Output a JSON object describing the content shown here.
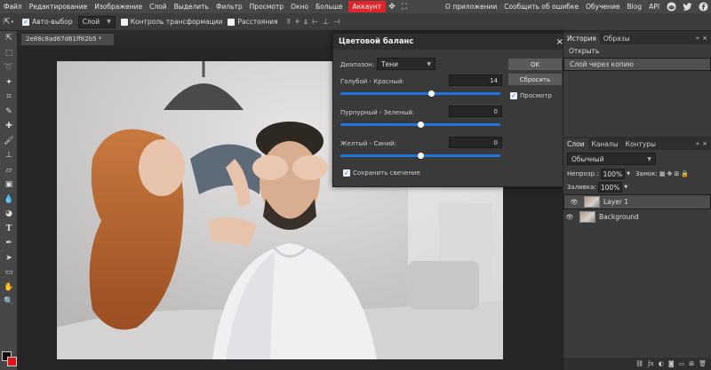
{
  "menu": {
    "items": [
      "Файл",
      "Редактирование",
      "Изображение",
      "Слой",
      "Выделить",
      "Фильтр",
      "Просмотр",
      "Окно",
      "Больше"
    ],
    "account": "Аккаунт",
    "links": [
      "О приложении",
      "Сообщить об ошибке",
      "Обучение",
      "Blog",
      "API"
    ]
  },
  "options": {
    "auto_select": "Авто-выбор",
    "layer_select": "Слой",
    "transform_controls": "Контроль трансформации",
    "distances": "Расстояния"
  },
  "document": {
    "tab_label": "2e88c8ad67d61ff82b5 *",
    "tab_close": "×"
  },
  "dialog": {
    "title": "Цветовой баланс",
    "close": "×",
    "range_label": "Диапазон:",
    "range_value": "Тени",
    "slider1": {
      "label": "Голубой - Красный:",
      "value": "14",
      "level": 14
    },
    "slider2": {
      "label": "Пурпурный - Зеленый:",
      "value": "0",
      "level": 0
    },
    "slider3": {
      "label": "Желтый - Синий:",
      "value": "0",
      "level": 0
    },
    "preserve_luminosity": "Сохранить свечение",
    "ok": "OK",
    "reset": "Сбросить",
    "preview": "Просмотр"
  },
  "history": {
    "tabs": [
      "История",
      "Образы"
    ],
    "items": [
      "Открыть",
      "Слой через копию"
    ]
  },
  "layers": {
    "tabs": [
      "Слои",
      "Каналы",
      "Контуры"
    ],
    "blend_mode": "Обычный",
    "opacity_label": "Непрозр.:",
    "opacity_value": "100%",
    "lock_label": "Замок:",
    "fill_label": "Заливка:",
    "fill_value": "100%",
    "rows": [
      "Layer 1",
      "Background"
    ]
  },
  "colors": {
    "accent": "#1c77e0",
    "account": "#e0242b",
    "foreground": "#111111",
    "background": "#e0141c"
  }
}
